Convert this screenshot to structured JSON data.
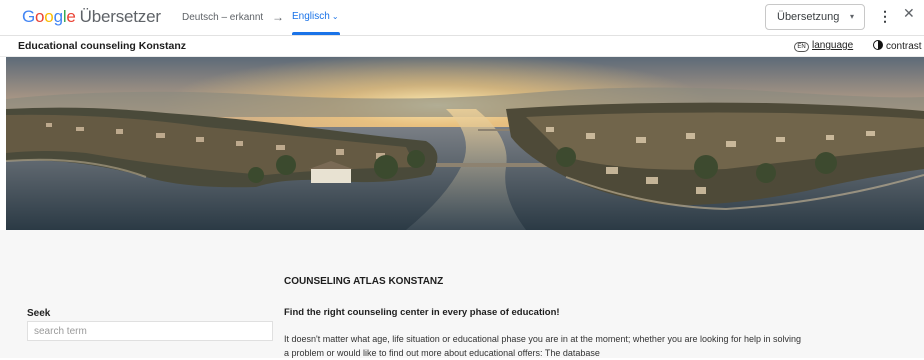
{
  "translate_bar": {
    "logo": {
      "g1": "G",
      "g2": "o",
      "g3": "o",
      "g4": "g",
      "g5": "l",
      "g6": "e",
      "product": "Übersetzer"
    },
    "source_language": "Deutsch – erkannt",
    "arrow": "→",
    "target_language": "Englisch",
    "target_chevron": "⌄",
    "mode_select": "Übersetzung",
    "mode_caret": "▾",
    "more_icon": "⋮",
    "close_icon": "✕"
  },
  "site_header": {
    "title": "Educational counseling Konstanz",
    "language_icon_text": "EN",
    "language_link": "language",
    "contrast_link": "contrast"
  },
  "main": {
    "atlas_title": "COUNSELING ATLAS KONSTANZ",
    "atlas_subtitle": "Find the right counseling center in every phase of education!",
    "atlas_body": "It doesn't matter what age, life situation or educational phase you are in at the moment; whether you are looking for help in solving a problem or would like to find out more about educational offers: The database"
  },
  "search": {
    "label": "Seek",
    "placeholder": "search term"
  },
  "colors": {
    "google_blue": "#4285f4",
    "google_red": "#ea4335",
    "google_yellow": "#fbbc05",
    "google_green": "#34a853",
    "accent": "#1a73e8",
    "content_bg": "#f7f7f7"
  }
}
